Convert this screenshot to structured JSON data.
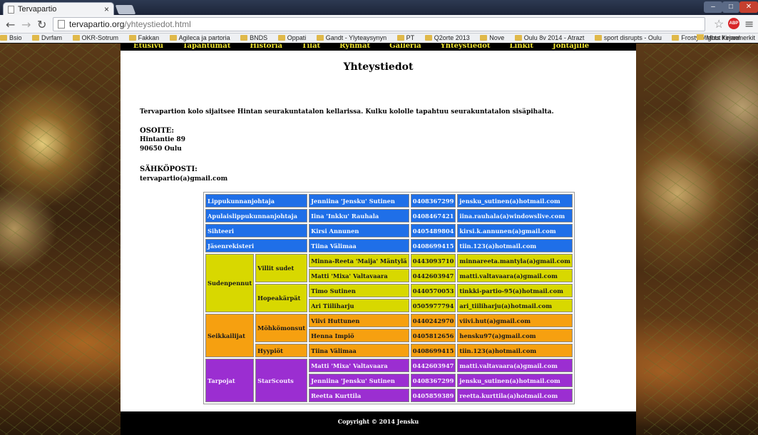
{
  "browser": {
    "tab_title": "Tervapartio",
    "tab_close": "×",
    "url_host": "tervapartio.org",
    "url_path": "/yhteystiedot.html",
    "window_min": "–",
    "window_max": "□",
    "window_close": "✕",
    "bookmarks": [
      "Bsio",
      "Dvrfam",
      "OKR-Sotrum",
      "Fakkan",
      "Agileca ja partoria",
      "BNDS",
      "Oppati",
      "Gandt - Ylyteaysynyn",
      "PT",
      "Q2orte 2013",
      "Nove",
      "Oulu 8v 2014 - Atrazt",
      "sport disrupts - Oulu",
      "Frosty Mights Kernel"
    ],
    "other_bookmarks": "Muut kirjanmerkit"
  },
  "site": {
    "nav": [
      "Etusivu",
      "Tapahtumat",
      "Historia",
      "Tilat",
      "Ryhmät",
      "Galleria",
      "Yhteystiedot",
      "Linkit",
      "Johtajille"
    ],
    "heading": "Yhteystiedot",
    "intro": "Tervapartion kolo sijaitsee Hintan seurakuntatalon kellarissa. Kulku kololle tapahtuu seurakuntatalon sisäpihalta.",
    "address_label": "OSOITE:",
    "address_line1": "Hintantie 89",
    "address_line2": "90650 Oulu",
    "email_label": "SÄHKÖPOSTI:",
    "email_value": "tervapartio(a)gmail.com",
    "footer": "Copyright © 2014 Jensku"
  },
  "contacts": {
    "leaders": [
      {
        "role": "Lippukunnanjohtaja",
        "name": "Jenniina 'Jensku' Sutinen",
        "phone": "0408367299",
        "email": "jensku_sutinen(a)hotmail.com"
      },
      {
        "role": "Apulaislippukunnanjohtaja",
        "name": "Iina 'Inkku' Rauhala",
        "phone": "0408467421",
        "email": "iina.rauhala(a)windowslive.com"
      },
      {
        "role": "Sihteeri",
        "name": "Kirsi Annunen",
        "phone": "0405489804",
        "email": "kirsi.k.annunen(a)gmail.com"
      },
      {
        "role": "Jäsenrekisteri",
        "name": "Tiina Välimaa",
        "phone": "0408699415",
        "email": "tiin.123(a)hotmail.com"
      }
    ],
    "sudenpennut": {
      "age_group": "Sudenpennut",
      "villit_sudet": {
        "group": "Villit sudet",
        "rows": [
          {
            "name": "Minna-Reeta 'Maija' Mäntylä",
            "phone": "0443093710",
            "email": "minnareeta.mantyla(a)gmail.com"
          },
          {
            "name": "Matti 'Mixa' Valtavaara",
            "phone": "0442603947",
            "email": "matti.valtavaara(a)gmail.com"
          }
        ]
      },
      "hopeakarpat": {
        "group": "Hopeakärpät",
        "rows": [
          {
            "name": "Timo Sutinen",
            "phone": "0440570053",
            "email": "tinkki-partio-95(a)hotmail.com"
          },
          {
            "name": "Ari Tiiliharju",
            "phone": "0505977794",
            "email": "ari_tiiliharju(a)hotmail.com"
          }
        ]
      }
    },
    "seikkailijat": {
      "age_group": "Seikkailijat",
      "mohkomonsut": {
        "group": "Möhkömonsut",
        "rows": [
          {
            "name": "Viivi Huttunen",
            "phone": "0440242970",
            "email": "viivi.hut(a)gmail.com"
          },
          {
            "name": "Henna Impiö",
            "phone": "0405812656",
            "email": "hensku97(a)gmail.com"
          }
        ]
      },
      "hyypiot": {
        "group": "Hyypiöt",
        "rows": [
          {
            "name": "Tiina Välimaa",
            "phone": "0408699415",
            "email": "tiin.123(a)hotmail.com"
          }
        ]
      }
    },
    "tarpojat": {
      "age_group": "Tarpojat",
      "starscouts": {
        "group": "StarScouts",
        "rows": [
          {
            "name": "Matti 'Mixa' Valtavaara",
            "phone": "0442603947",
            "email": "matti.valtavaara(a)gmail.com"
          },
          {
            "name": "Jenniina 'Jensku' Sutinen",
            "phone": "0408367299",
            "email": "jensku_sutinen(a)hotmail.com"
          },
          {
            "name": "Reetta Kurttila",
            "phone": "0405859389",
            "email": "reetta.kurttila(a)hotmail.com"
          }
        ]
      }
    }
  },
  "colors": {
    "leaders": "#1f6fe8",
    "sudenpennut": "#d8d800",
    "seikkailijat": "#f6a010",
    "tarpojat": "#9b2ed1",
    "nav_text": "#f0e530"
  }
}
